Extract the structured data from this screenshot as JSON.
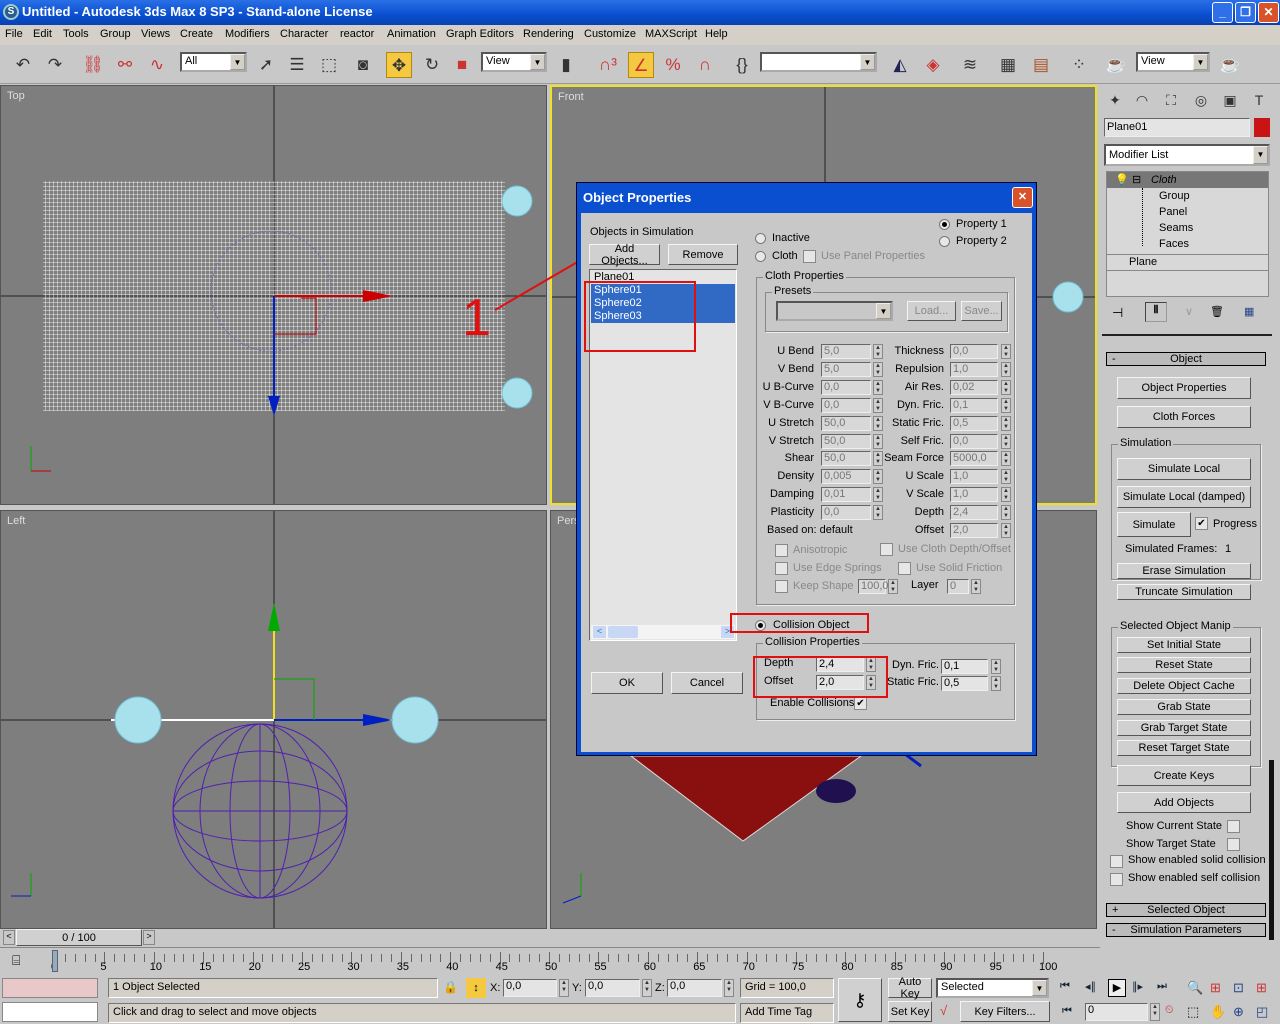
{
  "window": {
    "title": "Untitled - Autodesk 3ds Max 8 SP3  - Stand-alone License",
    "min": "_",
    "max": "❐",
    "close": "✕"
  },
  "menu": [
    "File",
    "Edit",
    "Tools",
    "Group",
    "Views",
    "Create",
    "Modifiers",
    "Character",
    "reactor",
    "Animation",
    "Graph Editors",
    "Rendering",
    "Customize",
    "MAXScript",
    "Help"
  ],
  "toolbar": {
    "selection_filter": "All",
    "ref_coord": "View",
    "named_sets": "",
    "render_type": "View"
  },
  "viewports": {
    "top": "Top",
    "front": "Front",
    "left": "Left",
    "perspective": "Perspective",
    "annotation_number": "1"
  },
  "command_panel": {
    "object_name": "Plane01",
    "object_color": "#c81414",
    "modifier_list": "Modifier List",
    "stack": {
      "cloth": "Cloth",
      "sub": [
        "Group",
        "Panel",
        "Seams",
        "Faces"
      ],
      "base": "Plane"
    },
    "rollout_object": "Object",
    "rollout_object_sign": "-",
    "object_properties": "Object Properties",
    "cloth_forces": "Cloth Forces",
    "simulation_group": "Simulation",
    "simulate_local": "Simulate Local",
    "simulate_local_damped": "Simulate Local (damped)",
    "simulate": "Simulate",
    "progress": "Progress",
    "progress_checked": true,
    "simulated_frames_label": "Simulated Frames:",
    "simulated_frames": "1",
    "erase_simulation": "Erase Simulation",
    "truncate_simulation": "Truncate Simulation",
    "manip_group": "Selected Object Manip",
    "manip_buttons": [
      "Set Initial State",
      "Reset State",
      "Delete Object Cache",
      "Grab State",
      "Grab Target State",
      "Reset Target State"
    ],
    "create_keys": "Create Keys",
    "add_objects": "Add Objects",
    "show_current_state": "Show Current State",
    "show_target_state": "Show Target State",
    "show_solid_collision": "Show enabled solid collision",
    "show_self_collision": "Show enabled self collision",
    "rollout_selected_object": "Selected Object",
    "rollout_selected_sign": "+",
    "rollout_sim_params": "Simulation Parameters",
    "rollout_sim_sign": "-"
  },
  "dialog": {
    "title": "Object Properties",
    "close": "✕",
    "objects_label": "Objects in Simulation",
    "add_objects": "Add Objects...",
    "remove": "Remove",
    "objects": [
      {
        "name": "Plane01",
        "selected": false
      },
      {
        "name": "Sphere01",
        "selected": true
      },
      {
        "name": "Sphere02",
        "selected": true
      },
      {
        "name": "Sphere03",
        "selected": true
      }
    ],
    "property1": "Property 1",
    "property2": "Property 2",
    "property_selected": "Property 1",
    "inactive": "Inactive",
    "cloth": "Cloth",
    "use_panel_properties": "Use Panel Properties",
    "cloth_properties": "Cloth Properties",
    "presets": "Presets",
    "load": "Load...",
    "save": "Save...",
    "left_fields": [
      [
        "U Bend",
        "5,0"
      ],
      [
        "V Bend",
        "5,0"
      ],
      [
        "U B-Curve",
        "0,0"
      ],
      [
        "V B-Curve",
        "0,0"
      ],
      [
        "U Stretch",
        "50,0"
      ],
      [
        "V Stretch",
        "50,0"
      ],
      [
        "Shear",
        "50,0"
      ],
      [
        "Density",
        "0,005"
      ],
      [
        "Damping",
        "0,01"
      ],
      [
        "Plasticity",
        "0,0"
      ]
    ],
    "right_fields": [
      [
        "Thickness",
        "0,0"
      ],
      [
        "Repulsion",
        "1,0"
      ],
      [
        "Air Res.",
        "0,02"
      ],
      [
        "Dyn. Fric.",
        "0,1"
      ],
      [
        "Static Fric.",
        "0,5"
      ],
      [
        "Self Fric.",
        "0,0"
      ],
      [
        "Seam Force",
        "5000,0"
      ],
      [
        "U Scale",
        "1,0"
      ],
      [
        "V Scale",
        "1,0"
      ],
      [
        "Depth",
        "2,4"
      ],
      [
        "Offset",
        "2,0"
      ]
    ],
    "based_on": "Based on: default",
    "anisotropic": "Anisotropic",
    "use_cloth_depth": "Use Cloth Depth/Offset",
    "use_edge_springs": "Use Edge Springs",
    "use_solid_friction": "Use Solid Friction",
    "keep_shape": "Keep Shape",
    "keep_shape_value": "100,0",
    "layer": "Layer",
    "layer_value": "0",
    "collision_object": "Collision Object",
    "collision_properties": "Collision Properties",
    "depth": "Depth",
    "depth_value": "2,4",
    "offset": "Offset",
    "offset_value": "2,0",
    "dyn_fric": "Dyn. Fric.",
    "dyn_fric_value": "0,1",
    "static_fric": "Static Fric.",
    "static_fric_value": "0,5",
    "enable_collisions": "Enable Collisions",
    "enable_collisions_checked": true,
    "ok": "OK",
    "cancel": "Cancel"
  },
  "timeline": {
    "slider": "0 / 100",
    "current_frame": 0,
    "ticks": [
      "0",
      "5",
      "10",
      "15",
      "20",
      "25",
      "30",
      "35",
      "40",
      "45",
      "50",
      "55",
      "60",
      "65",
      "70",
      "75",
      "80",
      "85",
      "90",
      "95",
      "100"
    ]
  },
  "status": {
    "selection": "1 Object Selected",
    "prompt": "Click and drag to select and move objects",
    "x_label": "X:",
    "x": "0,0",
    "y_label": "Y:",
    "y": "0,0",
    "z_label": "Z:",
    "z": "0,0",
    "grid": "Grid = 100,0",
    "add_time_tag": "Add Time Tag",
    "auto_key": "Auto Key",
    "set_key": "Set Key",
    "key_mode": "Selected",
    "key_filters": "Key Filters...",
    "frame": "0"
  }
}
